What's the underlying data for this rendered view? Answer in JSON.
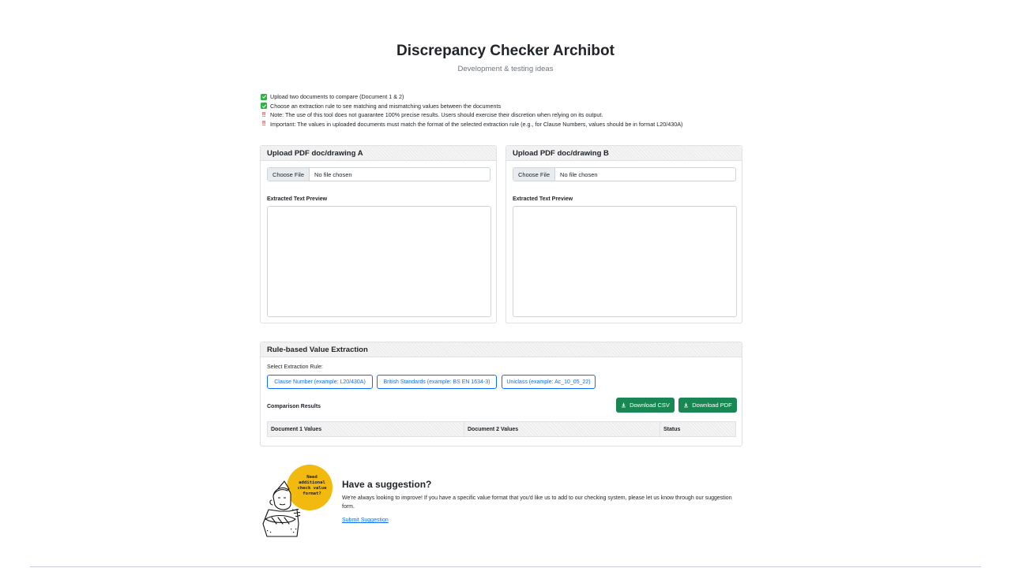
{
  "header": {
    "title": "Discrepancy Checker Archibot",
    "subtitle": "Development & testing ideas"
  },
  "notes": [
    {
      "icon": "check-icon",
      "text": "Upload two documents to compare (Document 1 & 2)"
    },
    {
      "icon": "check-icon",
      "text": "Choose an extraction rule to see matching and mismatching values between the documents"
    },
    {
      "icon": "warning-icon",
      "text": "Note: The use of this tool does not guarantee 100% precise results. Users should exercise their discretion when relying on its output."
    },
    {
      "icon": "warning-icon",
      "text": "Important: The values in uploaded documents must match the format of the selected extraction rule (e.g., for Clause Numbers, values should be in format L20/430A)"
    }
  ],
  "upload_a": {
    "title": "Upload PDF doc/drawing A",
    "choose_label": "Choose File",
    "status": "No file chosen",
    "preview_label": "Extracted Text Preview",
    "preview_value": ""
  },
  "upload_b": {
    "title": "Upload PDF doc/drawing B",
    "choose_label": "Choose File",
    "status": "No file chosen",
    "preview_label": "Extracted Text Preview",
    "preview_value": ""
  },
  "extraction": {
    "title": "Rule-based Value Extraction",
    "select_label": "Select Extraction Rule:",
    "rules": [
      "Clause Number (example: L20/430A)",
      "British Standards (example: BS EN 1634-3)",
      "Uniclass (example: Ac_10_05_22)"
    ],
    "results_label": "Comparison Results",
    "download_csv": "Download CSV",
    "download_pdf": "Download PDF",
    "columns": [
      "Document 1 Values",
      "Document 2 Values",
      "Status"
    ]
  },
  "suggestion": {
    "bubble_text": "Need additional check value format?",
    "title": "Have a suggestion?",
    "text": "We're always looking to improve! If you have a specific value format that you'd like us to add to our checking system, please let us know through our suggestion form.",
    "link": "Submit Suggestion"
  },
  "colors": {
    "accent": "#0d6efd",
    "success": "#198754",
    "check": "#2fb344",
    "warning": "#d63939",
    "bubble": "#f2b90f"
  }
}
